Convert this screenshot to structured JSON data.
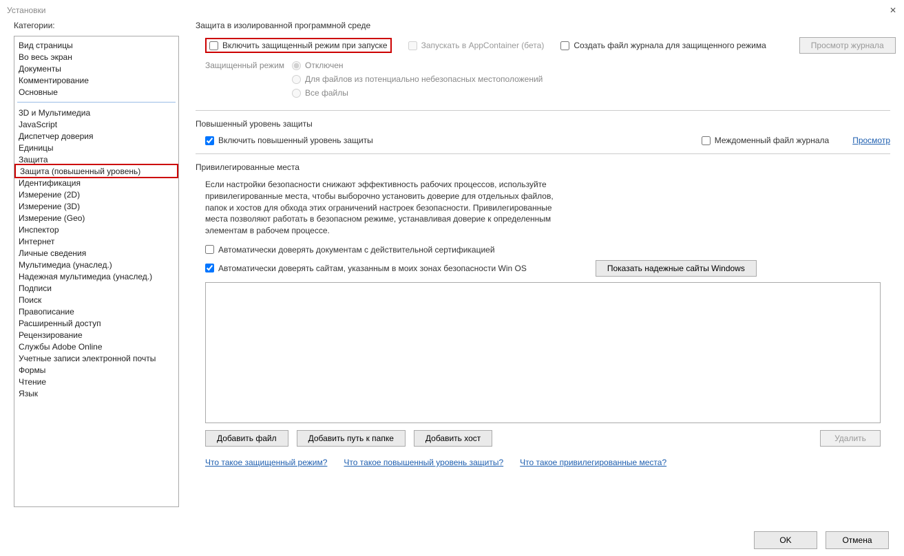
{
  "window": {
    "title": "Установки"
  },
  "sidebar": {
    "label": "Категории:",
    "group1": [
      "Вид страницы",
      "Во весь экран",
      "Документы",
      "Комментирование",
      "Основные"
    ],
    "group2": [
      "3D и Мультимедиа",
      "JavaScript",
      "Диспетчер доверия",
      "Единицы",
      "Защита",
      "Защита (повышенный уровень)",
      "Идентификация",
      "Измерение (2D)",
      "Измерение (3D)",
      "Измерение (Geo)",
      "Инспектор",
      "Интернет",
      "Личные сведения",
      "Мультимедиа (унаслед.)",
      "Надежная мультимедиа (унаслед.)",
      "Подписи",
      "Поиск",
      "Правописание",
      "Расширенный доступ",
      "Рецензирование",
      "Службы Adobe Online",
      "Учетные записи электронной почты",
      "Формы",
      "Чтение",
      "Язык"
    ],
    "selected": "Защита (повышенный уровень)"
  },
  "sandbox": {
    "title": "Защита в изолированной программной среде",
    "enable_protected": "Включить защищенный режим при запуске",
    "app_container": "Запускать в AppContainer (бета)",
    "create_log": "Создать файл журнала для защищенного режима",
    "view_log_btn": "Просмотр журнала",
    "mode_label": "Защищенный режим",
    "radio": {
      "off": "Отключен",
      "unsafe": "Для файлов из потенциально небезопасных местоположений",
      "all": "Все файлы"
    }
  },
  "enhanced": {
    "title": "Повышенный уровень защиты",
    "enable": "Включить повышенный уровень защиты",
    "cross_log": "Междоменный файл журнала",
    "view": "Просмотр"
  },
  "priv": {
    "title": "Привилегированные места",
    "desc": "Если настройки безопасности снижают эффективность рабочих процессов, используйте привилегированные места, чтобы выборочно установить доверие для отдельных файлов, папок и хостов для обхода этих ограничений настроек безопасности. Привилегированные места позволяют работать в безопасном режиме, устанавливая доверие к определенным элементам в рабочем процессе.",
    "auto_trust_cert": "Автоматически доверять документам с действительной сертификацией",
    "auto_trust_os": "Автоматически доверять сайтам, указанным в моих зонах безопасности Win OS",
    "show_sites_btn": "Показать надежные сайты Windows",
    "add_file": "Добавить файл",
    "add_folder": "Добавить путь к папке",
    "add_host": "Добавить хост",
    "delete": "Удалить"
  },
  "help": {
    "q1": "Что такое защищенный режим?",
    "q2": "Что такое повышенный уровень защиты?",
    "q3": "Что такое привилегированные места?"
  },
  "footer": {
    "ok": "OK",
    "cancel": "Отмена"
  }
}
